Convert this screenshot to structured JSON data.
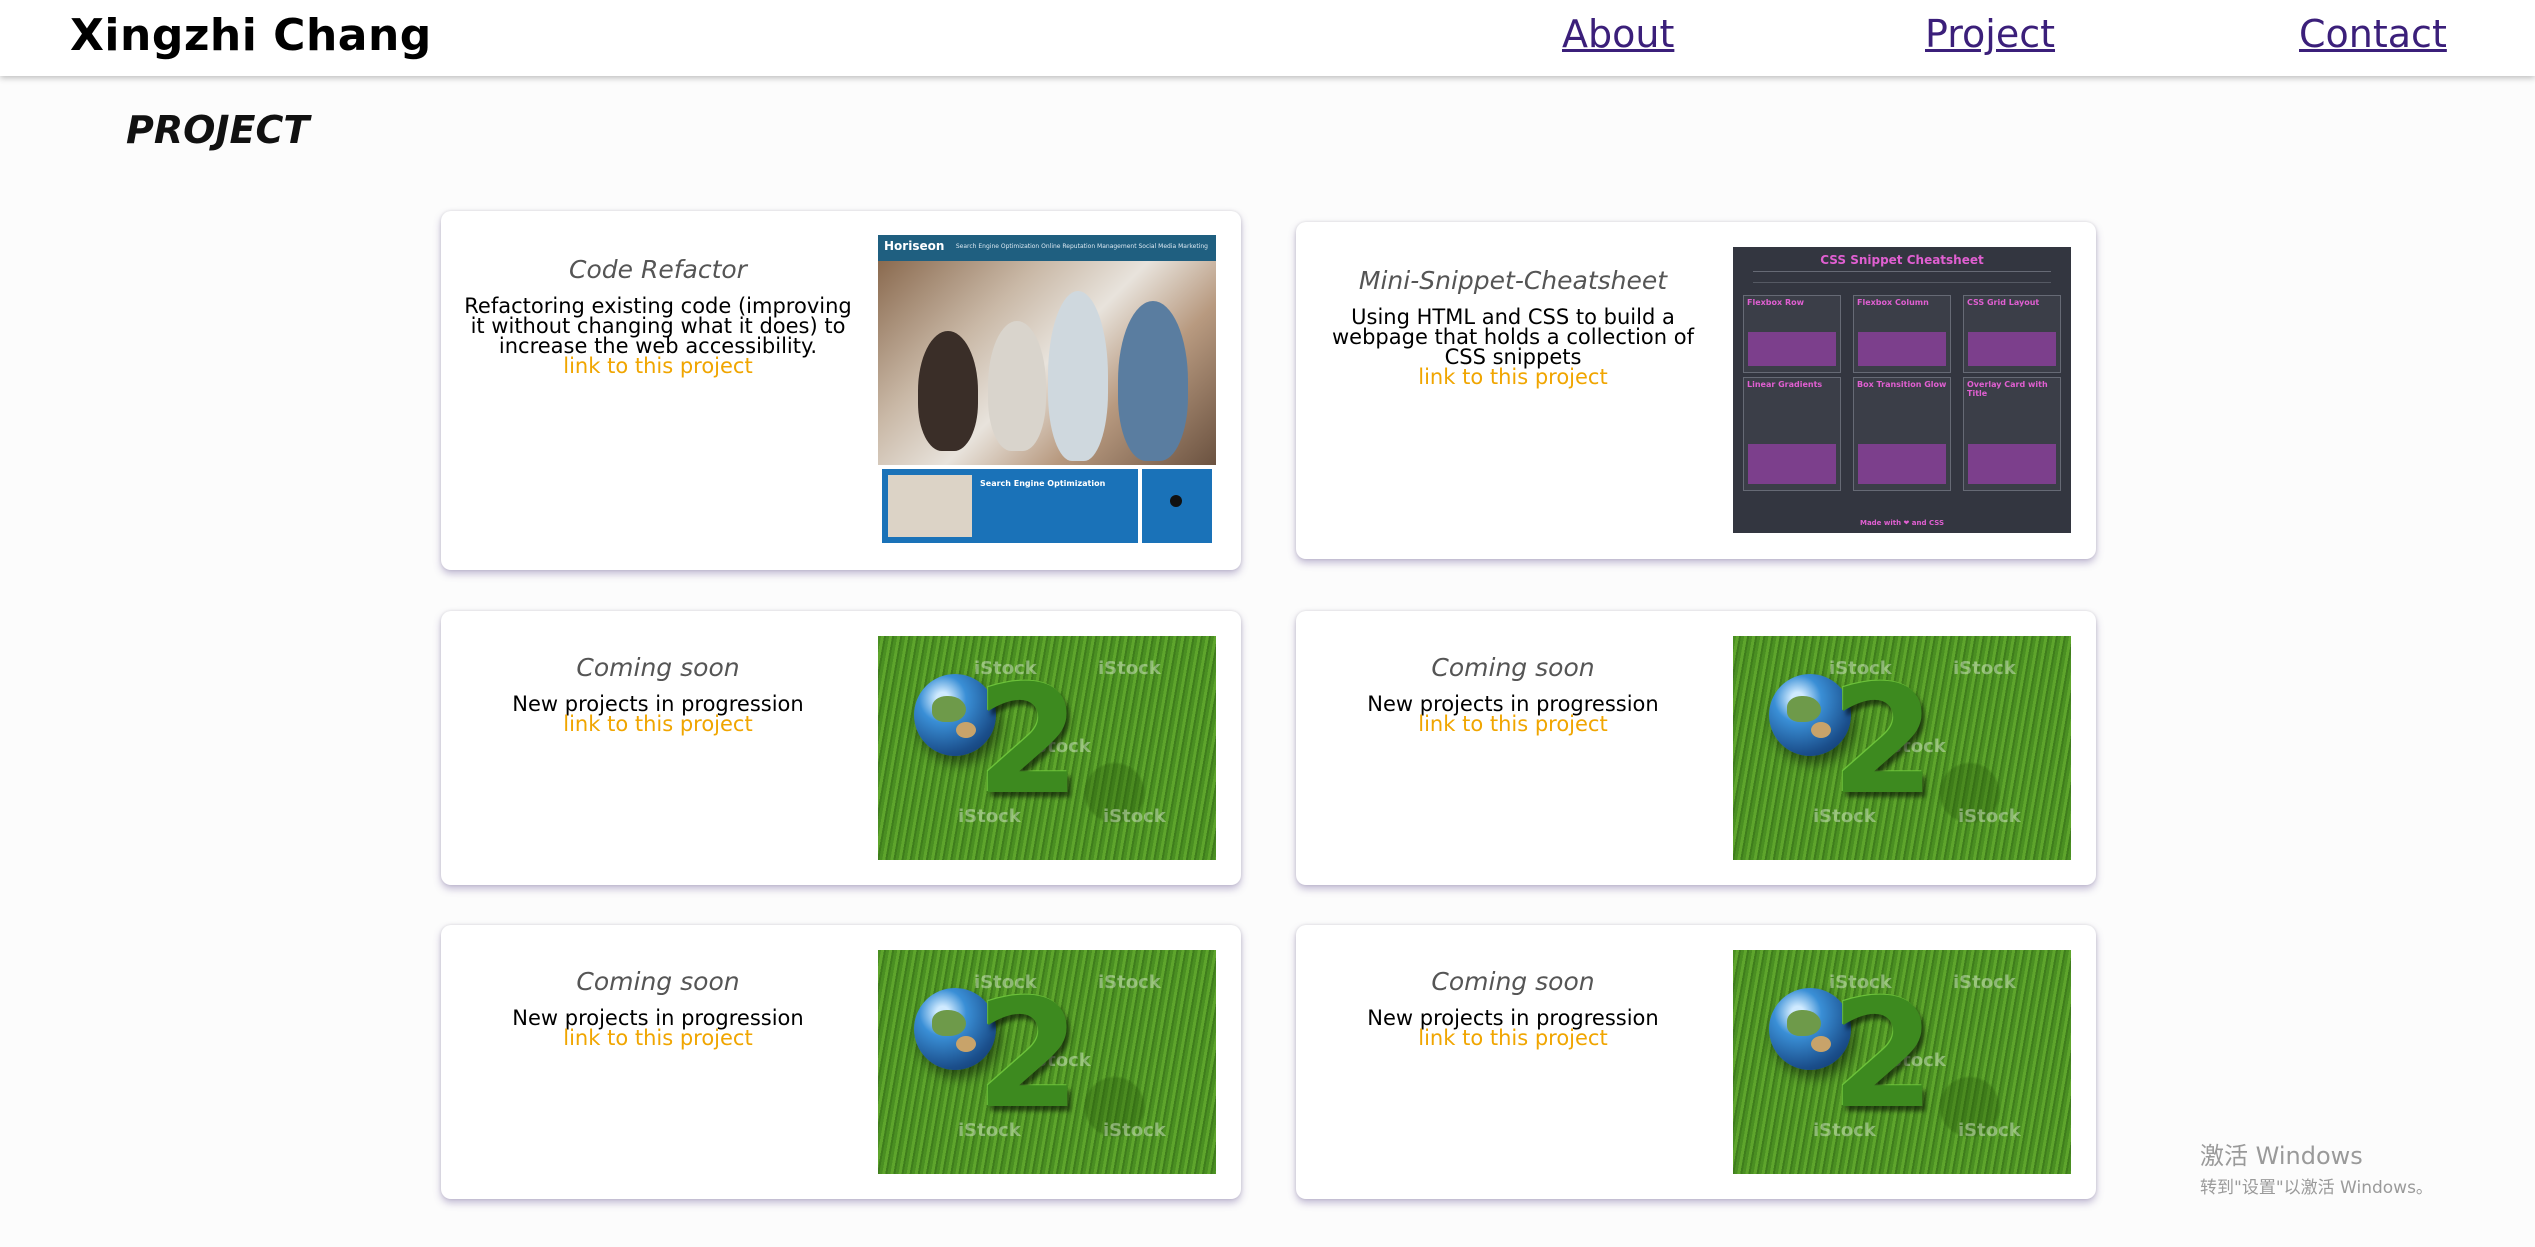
{
  "header": {
    "brand": "Xingzhi Chang",
    "nav": [
      "About",
      "Project",
      "Contact"
    ]
  },
  "page_title": "PROJECT",
  "cards": [
    {
      "title": "Code Refactor",
      "description": "Refactoring existing code (improving it without changing what it does) to increase the web accessibility.",
      "link": "link to this project",
      "thumbnail": {
        "logo": "Horiseon",
        "nav": "Search Engine Optimization    Online Reputation Management    Social Media Marketing",
        "panel_title": "Search Engine Optimization"
      }
    },
    {
      "title": "Mini-Snippet-Cheatsheet",
      "description": "Using HTML and CSS to build a webpage that holds a collection of CSS snippets",
      "link": "link to this project",
      "thumbnail": {
        "title": "CSS Snippet Cheatsheet",
        "boxes": [
          "Flexbox Row",
          "Flexbox Column",
          "CSS Grid Layout",
          "Linear Gradients",
          "Box Transition Glow",
          "Overlay Card with Title"
        ],
        "footer": "Made with ❤ and CSS"
      }
    },
    {
      "title": "Coming soon",
      "description": "New projects in progression",
      "link": "link to this project",
      "thumbnail": {
        "watermark": "iStock"
      }
    },
    {
      "title": "Coming soon",
      "description": "New projects in progression",
      "link": "link to this project",
      "thumbnail": {
        "watermark": "iStock"
      }
    },
    {
      "title": "Coming soon",
      "description": "New projects in progression",
      "link": "link to this project",
      "thumbnail": {
        "watermark": "iStock"
      }
    },
    {
      "title": "Coming soon",
      "description": "New projects in progression",
      "link": "link to this project",
      "thumbnail": {
        "watermark": "iStock"
      }
    }
  ],
  "thumb_digit": "2",
  "windows_watermark": {
    "line1": "激活 Windows",
    "line2": "转到\"设置\"以激活 Windows。"
  },
  "colors": {
    "nav_link": "#3b1f7a",
    "project_link": "#f0a500",
    "card_bg": "#ffffff",
    "page_bg": "#fcfcfc"
  }
}
